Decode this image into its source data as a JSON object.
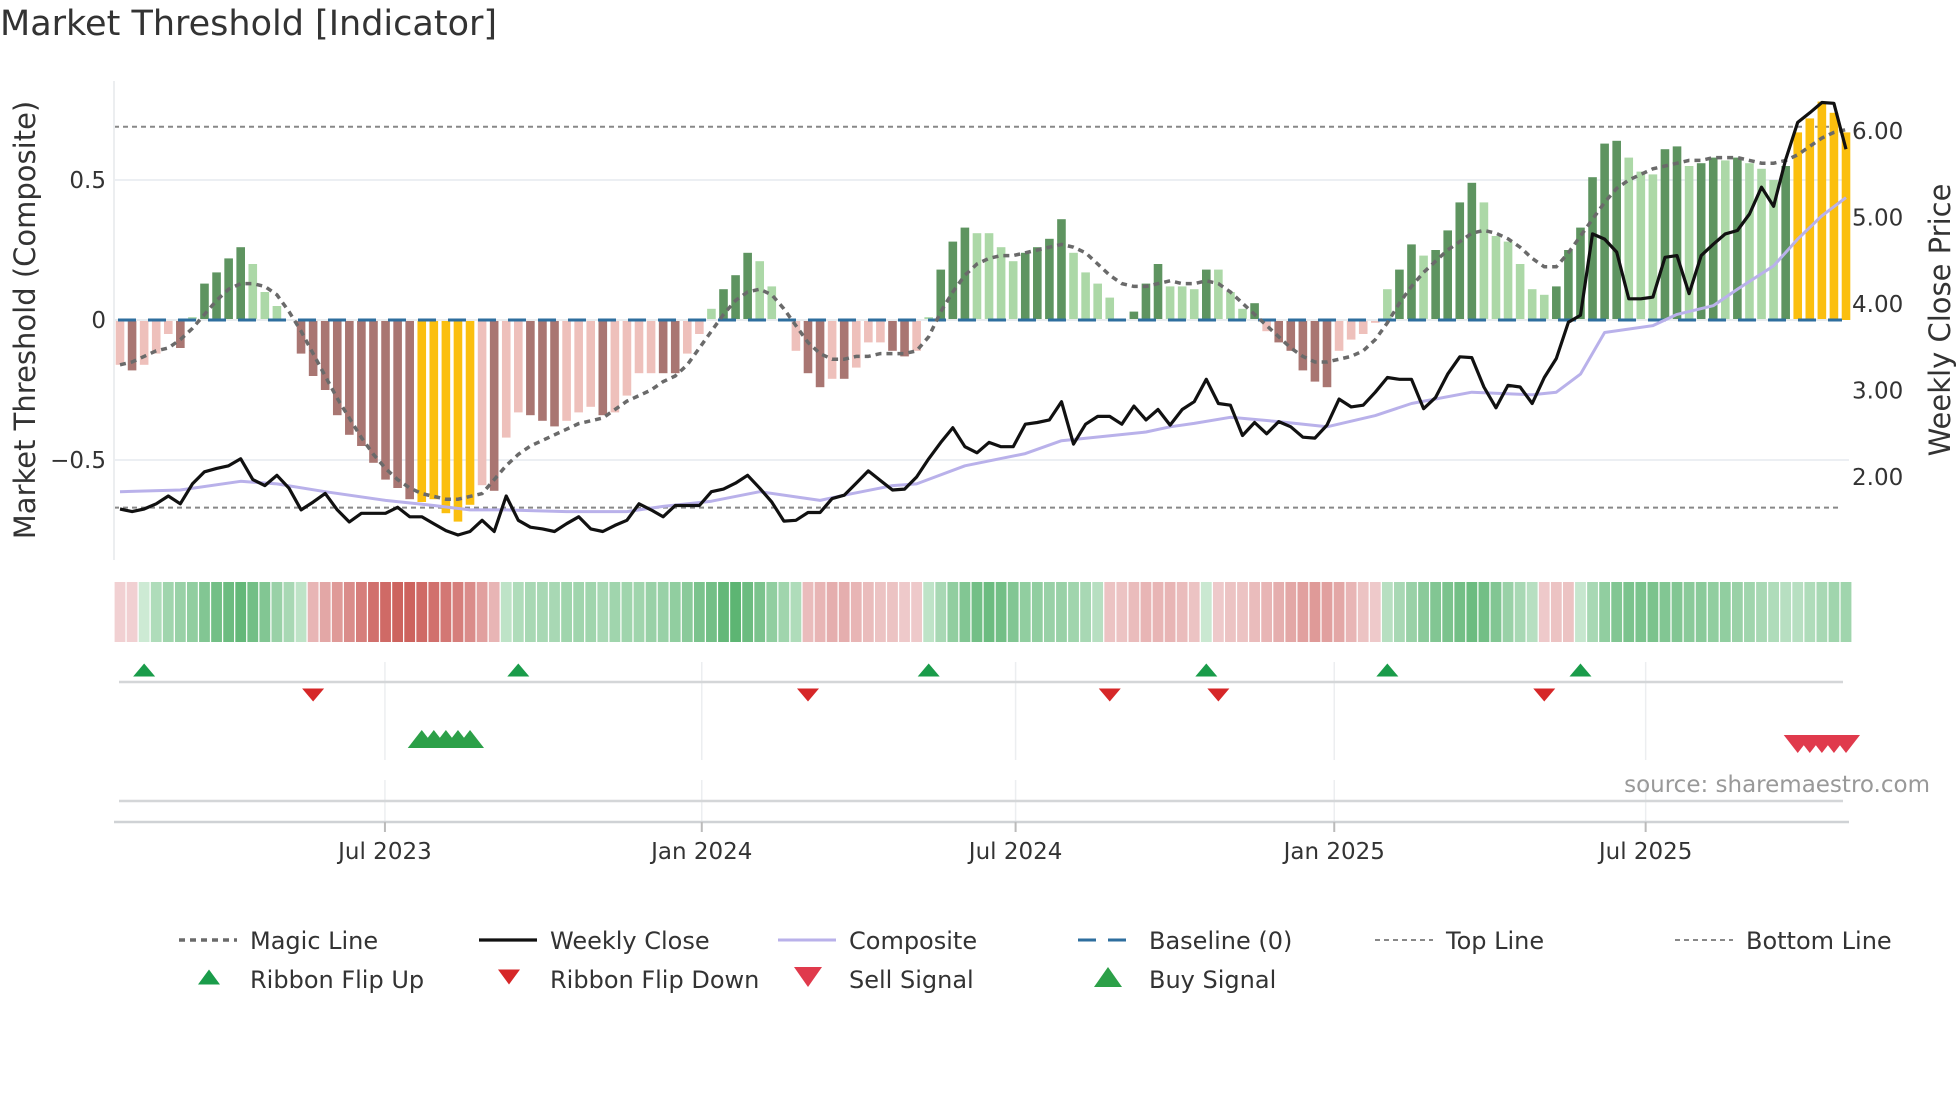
{
  "title": "Market Threshold [Indicator]",
  "source": "source: sharemaestro.com",
  "colors": {
    "bar_dark_green": "#5e9460",
    "bar_light_green": "#acd8a7",
    "bar_dark_red": "#a97672",
    "bar_light_red": "#eec0bb",
    "bar_extreme": "#fbbf0e",
    "magic_line": "#6a6a6a",
    "weekly_close": "#111111",
    "composite": "#b9b1ea",
    "baseline": "#2e6e9e",
    "threshold_lines": "#888888",
    "flip_up": "#1a9c4a",
    "flip_down": "#d62728",
    "sell": "#e03a4c",
    "buy": "#2ca048"
  },
  "chart_data": {
    "type": "bar",
    "title": "Market Threshold [Indicator]",
    "ylabel_left": "Market Threshold (Composite)",
    "ylabel_right": "Weekly Close Price",
    "xlabel": "",
    "ylim_left": [
      -0.855,
      0.855
    ],
    "ylim_right": [
      1.04,
      6.58
    ],
    "x_unit": "week index",
    "left_ticks": [
      {
        "label": "0.5",
        "value": 0.5
      },
      {
        "label": "0",
        "value": 0
      },
      {
        "label": "−0.5",
        "value": -0.5
      }
    ],
    "right_ticks": [
      {
        "label": "6.00",
        "value": 6
      },
      {
        "label": "5.00",
        "value": 5
      },
      {
        "label": "4.00",
        "value": 4
      },
      {
        "label": "3.00",
        "value": 3
      },
      {
        "label": "2.00",
        "value": 2
      }
    ],
    "x_ticks": [
      {
        "label": "Jul 2023",
        "week": 22.95
      },
      {
        "label": "Jan 2024",
        "week": 49.2
      },
      {
        "label": "Jul 2024",
        "week": 75.2
      },
      {
        "label": "Jan 2025",
        "week": 101.6
      },
      {
        "label": "Jul 2025",
        "week": 127.4
      }
    ],
    "top_line": 0.69,
    "bottom_line": -0.67,
    "baseline": 0,
    "threshold_bars": [
      -0.16,
      -0.18,
      -0.16,
      -0.12,
      -0.05,
      -0.1,
      0.01,
      0.13,
      0.17,
      0.22,
      0.26,
      0.2,
      0.1,
      0.05,
      0.0,
      -0.12,
      -0.2,
      -0.25,
      -0.34,
      -0.41,
      -0.45,
      -0.51,
      -0.57,
      -0.6,
      -0.64,
      -0.65,
      -0.64,
      -0.69,
      -0.72,
      -0.66,
      -0.59,
      -0.61,
      -0.42,
      -0.33,
      -0.34,
      -0.36,
      -0.38,
      -0.36,
      -0.33,
      -0.31,
      -0.34,
      -0.33,
      -0.27,
      -0.19,
      -0.19,
      -0.19,
      -0.19,
      -0.12,
      -0.05,
      0.04,
      0.11,
      0.16,
      0.24,
      0.21,
      0.12,
      0.0,
      -0.11,
      -0.19,
      -0.24,
      -0.21,
      -0.21,
      -0.17,
      -0.08,
      -0.08,
      -0.11,
      -0.13,
      -0.11,
      0.01,
      0.18,
      0.28,
      0.33,
      0.31,
      0.31,
      0.26,
      0.21,
      0.24,
      0.26,
      0.29,
      0.36,
      0.24,
      0.17,
      0.13,
      0.08,
      0.0,
      0.03,
      0.13,
      0.2,
      0.12,
      0.12,
      0.11,
      0.18,
      0.18,
      0.1,
      0.04,
      0.06,
      -0.04,
      -0.08,
      -0.11,
      -0.18,
      -0.22,
      -0.24,
      -0.11,
      -0.07,
      -0.05,
      -0.01,
      0.11,
      0.18,
      0.27,
      0.23,
      0.25,
      0.32,
      0.42,
      0.49,
      0.42,
      0.3,
      0.28,
      0.2,
      0.11,
      0.09,
      0.12,
      0.25,
      0.33,
      0.51,
      0.63,
      0.64,
      0.58,
      0.53,
      0.52,
      0.61,
      0.62,
      0.55,
      0.56,
      0.58,
      0.57,
      0.58,
      0.56,
      0.54,
      0.5,
      0.55,
      0.67,
      0.72,
      0.78,
      0.74,
      0.67
    ],
    "bar_shades": [
      "lr",
      "dr",
      "lr",
      "lr",
      "lr",
      "dr",
      "lg",
      "dg",
      "dg",
      "dg",
      "dg",
      "lg",
      "lg",
      "lg",
      "lr",
      "dr",
      "dr",
      "dr",
      "dr",
      "dr",
      "dr",
      "dr",
      "dr",
      "dr",
      "dr",
      "y",
      "y",
      "y",
      "y",
      "y",
      "lr",
      "dr",
      "lr",
      "lr",
      "dr",
      "dr",
      "dr",
      "lr",
      "lr",
      "lr",
      "dr",
      "lr",
      "lr",
      "lr",
      "lr",
      "dr",
      "dr",
      "lr",
      "lr",
      "lg",
      "dg",
      "dg",
      "dg",
      "lg",
      "lg",
      "lr",
      "lr",
      "dr",
      "dr",
      "lr",
      "dr",
      "lr",
      "lr",
      "lr",
      "dr",
      "dr",
      "lr",
      "lg",
      "dg",
      "dg",
      "dg",
      "lg",
      "lg",
      "lg",
      "lg",
      "dg",
      "dg",
      "dg",
      "dg",
      "lg",
      "lg",
      "lg",
      "lg",
      "lg",
      "dg",
      "dg",
      "dg",
      "lg",
      "lg",
      "lg",
      "dg",
      "lg",
      "lg",
      "lg",
      "dg",
      "lr",
      "dr",
      "dr",
      "dr",
      "dr",
      "dr",
      "lr",
      "lr",
      "lr",
      "lr",
      "lg",
      "dg",
      "dg",
      "lg",
      "dg",
      "dg",
      "dg",
      "dg",
      "lg",
      "lg",
      "lg",
      "lg",
      "lg",
      "lg",
      "dg",
      "dg",
      "dg",
      "dg",
      "dg",
      "dg",
      "lg",
      "lg",
      "lg",
      "dg",
      "dg",
      "lg",
      "dg",
      "dg",
      "lg",
      "dg",
      "lg",
      "lg",
      "lg",
      "dg",
      "y",
      "y",
      "y",
      "y",
      "y"
    ],
    "magic_line": [
      -0.16,
      -0.15,
      -0.13,
      -0.11,
      -0.1,
      -0.07,
      -0.03,
      0.02,
      0.07,
      0.11,
      0.13,
      0.13,
      0.12,
      0.09,
      0.03,
      -0.04,
      -0.12,
      -0.2,
      -0.28,
      -0.35,
      -0.42,
      -0.48,
      -0.53,
      -0.57,
      -0.6,
      -0.62,
      -0.63,
      -0.64,
      -0.64,
      -0.63,
      -0.62,
      -0.57,
      -0.52,
      -0.48,
      -0.45,
      -0.43,
      -0.41,
      -0.39,
      -0.37,
      -0.36,
      -0.35,
      -0.32,
      -0.29,
      -0.27,
      -0.25,
      -0.22,
      -0.2,
      -0.16,
      -0.1,
      -0.04,
      0.02,
      0.07,
      0.1,
      0.11,
      0.09,
      0.04,
      -0.02,
      -0.08,
      -0.12,
      -0.14,
      -0.14,
      -0.13,
      -0.13,
      -0.12,
      -0.12,
      -0.12,
      -0.11,
      -0.06,
      0.03,
      0.1,
      0.16,
      0.2,
      0.22,
      0.23,
      0.23,
      0.24,
      0.25,
      0.26,
      0.27,
      0.26,
      0.24,
      0.2,
      0.16,
      0.13,
      0.12,
      0.12,
      0.13,
      0.14,
      0.13,
      0.13,
      0.14,
      0.13,
      0.1,
      0.06,
      0.02,
      -0.02,
      -0.06,
      -0.1,
      -0.13,
      -0.15,
      -0.15,
      -0.14,
      -0.13,
      -0.11,
      -0.07,
      -0.01,
      0.06,
      0.12,
      0.17,
      0.21,
      0.25,
      0.28,
      0.31,
      0.32,
      0.31,
      0.29,
      0.26,
      0.22,
      0.19,
      0.19,
      0.24,
      0.3,
      0.36,
      0.42,
      0.47,
      0.5,
      0.52,
      0.54,
      0.55,
      0.56,
      0.57,
      0.57,
      0.58,
      0.58,
      0.58,
      0.57,
      0.56,
      0.56,
      0.57,
      0.59,
      0.62,
      0.65,
      0.67,
      0.68
    ],
    "weekly_close": [
      1.63,
      1.6,
      1.63,
      1.69,
      1.78,
      1.69,
      1.92,
      2.06,
      2.1,
      2.13,
      2.21,
      1.97,
      1.9,
      2.02,
      1.87,
      1.62,
      1.71,
      1.81,
      1.62,
      1.48,
      1.58,
      1.58,
      1.58,
      1.65,
      1.54,
      1.54,
      1.46,
      1.38,
      1.33,
      1.37,
      1.5,
      1.37,
      1.78,
      1.5,
      1.42,
      1.4,
      1.37,
      1.46,
      1.54,
      1.4,
      1.37,
      1.44,
      1.5,
      1.69,
      1.62,
      1.54,
      1.67,
      1.67,
      1.67,
      1.83,
      1.86,
      1.93,
      2.02,
      1.87,
      1.71,
      1.49,
      1.5,
      1.59,
      1.59,
      1.75,
      1.79,
      1.93,
      2.07,
      1.96,
      1.85,
      1.86,
      2.0,
      2.21,
      2.4,
      2.57,
      2.35,
      2.28,
      2.4,
      2.35,
      2.35,
      2.61,
      2.63,
      2.66,
      2.87,
      2.38,
      2.61,
      2.7,
      2.7,
      2.61,
      2.82,
      2.66,
      2.78,
      2.6,
      2.78,
      2.87,
      3.13,
      2.85,
      2.83,
      2.48,
      2.63,
      2.5,
      2.64,
      2.58,
      2.46,
      2.45,
      2.6,
      2.9,
      2.81,
      2.83,
      2.98,
      3.15,
      3.13,
      3.13,
      2.79,
      2.92,
      3.19,
      3.39,
      3.38,
      3.04,
      2.8,
      3.06,
      3.04,
      2.85,
      3.15,
      3.37,
      3.79,
      3.87,
      4.81,
      4.75,
      4.6,
      4.06,
      4.06,
      4.08,
      4.54,
      4.56,
      4.12,
      4.56,
      4.69,
      4.81,
      4.85,
      5.04,
      5.35,
      5.13,
      5.67,
      6.1,
      6.21,
      6.33,
      6.32,
      5.79
    ],
    "composite_line": [
      [
        1,
        1.83
      ],
      [
        6,
        1.85
      ],
      [
        11,
        1.95
      ],
      [
        14,
        1.92
      ],
      [
        18,
        1.83
      ],
      [
        23,
        1.73
      ],
      [
        27,
        1.67
      ],
      [
        30,
        1.62
      ],
      [
        33,
        1.62
      ],
      [
        38,
        1.6
      ],
      [
        43,
        1.6
      ],
      [
        46,
        1.66
      ],
      [
        50,
        1.72
      ],
      [
        54,
        1.83
      ],
      [
        59,
        1.73
      ],
      [
        61,
        1.79
      ],
      [
        65,
        1.9
      ],
      [
        67,
        1.92
      ],
      [
        71,
        2.13
      ],
      [
        76,
        2.27
      ],
      [
        79,
        2.42
      ],
      [
        86,
        2.52
      ],
      [
        88,
        2.58
      ],
      [
        90,
        2.62
      ],
      [
        93,
        2.69
      ],
      [
        97,
        2.64
      ],
      [
        101,
        2.58
      ],
      [
        105,
        2.71
      ],
      [
        108,
        2.85
      ],
      [
        113,
        2.98
      ],
      [
        118,
        2.95
      ],
      [
        120,
        2.98
      ],
      [
        122,
        3.19
      ],
      [
        124,
        3.67
      ],
      [
        128,
        3.75
      ],
      [
        130,
        3.88
      ],
      [
        133,
        3.98
      ],
      [
        135,
        4.17
      ],
      [
        138,
        4.44
      ],
      [
        140,
        4.75
      ],
      [
        142,
        5.02
      ],
      [
        144,
        5.23
      ]
    ],
    "ribbon": [
      -0.1,
      -0.1,
      0.1,
      0.3,
      0.4,
      0.45,
      0.5,
      0.6,
      0.7,
      0.75,
      0.8,
      0.7,
      0.6,
      0.45,
      0.35,
      0.2,
      -0.3,
      -0.4,
      -0.5,
      -0.6,
      -0.7,
      -0.8,
      -0.85,
      -0.9,
      -0.9,
      -0.85,
      -0.8,
      -0.75,
      -0.7,
      -0.6,
      -0.45,
      -0.3,
      0.2,
      0.3,
      0.35,
      0.35,
      0.35,
      0.4,
      0.4,
      0.4,
      0.35,
      0.4,
      0.4,
      0.4,
      0.45,
      0.45,
      0.5,
      0.55,
      0.65,
      0.7,
      0.8,
      0.85,
      0.75,
      0.65,
      0.5,
      0.4,
      0.3,
      -0.25,
      -0.3,
      -0.35,
      -0.35,
      -0.3,
      -0.25,
      -0.2,
      -0.2,
      -0.15,
      -0.15,
      0.2,
      0.35,
      0.5,
      0.6,
      0.7,
      0.75,
      0.7,
      0.6,
      0.5,
      0.5,
      0.45,
      0.45,
      0.4,
      0.35,
      0.25,
      -0.2,
      -0.2,
      -0.25,
      -0.3,
      -0.3,
      -0.3,
      -0.25,
      -0.2,
      0.12,
      -0.15,
      -0.2,
      -0.2,
      -0.25,
      -0.3,
      -0.35,
      -0.4,
      -0.45,
      -0.5,
      -0.45,
      -0.4,
      -0.3,
      -0.2,
      -0.15,
      0.25,
      0.35,
      0.45,
      0.55,
      0.6,
      0.65,
      0.7,
      0.75,
      0.7,
      0.6,
      0.45,
      0.35,
      0.25,
      -0.15,
      -0.2,
      -0.2,
      0.15,
      0.35,
      0.5,
      0.6,
      0.65,
      0.65,
      0.65,
      0.6,
      0.6,
      0.55,
      0.55,
      0.5,
      0.5,
      0.45,
      0.4,
      0.35,
      0.3,
      0.25,
      0.25,
      0.3,
      0.35,
      0.4,
      0.4
    ],
    "ribbon_flip_up": [
      3,
      34,
      68,
      91,
      106,
      122
    ],
    "ribbon_flip_down": [
      17,
      58,
      83,
      92,
      119
    ],
    "buy_signal": [
      26,
      27,
      28,
      29,
      30
    ],
    "sell_signal": [
      140,
      141,
      142,
      143,
      144
    ],
    "legend": {
      "placement": "bottom",
      "items": [
        {
          "label": "Magic Line",
          "kind": "dotted"
        },
        {
          "label": "Weekly Close",
          "kind": "solid"
        },
        {
          "label": "Composite",
          "kind": "composite"
        },
        {
          "label": "Baseline (0)",
          "kind": "baseline"
        },
        {
          "label": "Top Line",
          "kind": "thin-dash"
        },
        {
          "label": "Bottom Line",
          "kind": "thin-dash"
        },
        {
          "label": "Ribbon Flip Up",
          "kind": "flip-up"
        },
        {
          "label": "Ribbon Flip Down",
          "kind": "flip-down"
        },
        {
          "label": "Sell Signal",
          "kind": "sell"
        },
        {
          "label": "Buy Signal",
          "kind": "buy"
        }
      ]
    }
  }
}
